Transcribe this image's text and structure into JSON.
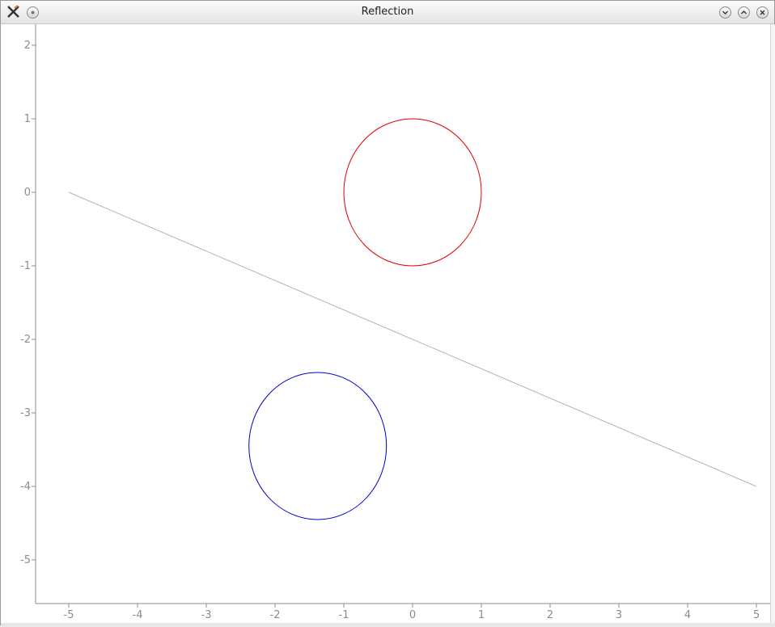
{
  "window": {
    "title": "Reflection",
    "app_icon": "x-tools-icon",
    "buttons": [
      {
        "name": "minimize-button",
        "icon": "chevron-down-icon"
      },
      {
        "name": "maximize-button",
        "icon": "chevron-up-icon"
      },
      {
        "name": "close-button",
        "icon": "close-icon"
      }
    ],
    "menu_button_icon": "circle-menu-icon"
  },
  "chart_data": {
    "type": "line",
    "title": "",
    "xlabel": "",
    "ylabel": "",
    "xlim": [
      -5.5,
      5.5
    ],
    "ylim": [
      -5.6,
      2.3
    ],
    "xticks": [
      -5,
      -4,
      -3,
      -2,
      -1,
      0,
      1,
      2,
      3,
      4,
      5
    ],
    "yticks": [
      2,
      1,
      0,
      -1,
      -2,
      -3,
      -4,
      -5
    ],
    "grid": false,
    "series": [
      {
        "kind": "line",
        "color": "#b3b3b3",
        "points": [
          [
            -5,
            0
          ],
          [
            5,
            -4
          ]
        ]
      },
      {
        "kind": "circle",
        "color": "#e00000",
        "center": [
          0,
          0
        ],
        "radius": 1
      },
      {
        "kind": "circle",
        "color": "#0000d0",
        "center": [
          -1.38,
          -3.45
        ],
        "radius": 1
      }
    ],
    "colors": {
      "axis": "#8c8c8c",
      "tick_text": "#8c8c8c"
    }
  }
}
